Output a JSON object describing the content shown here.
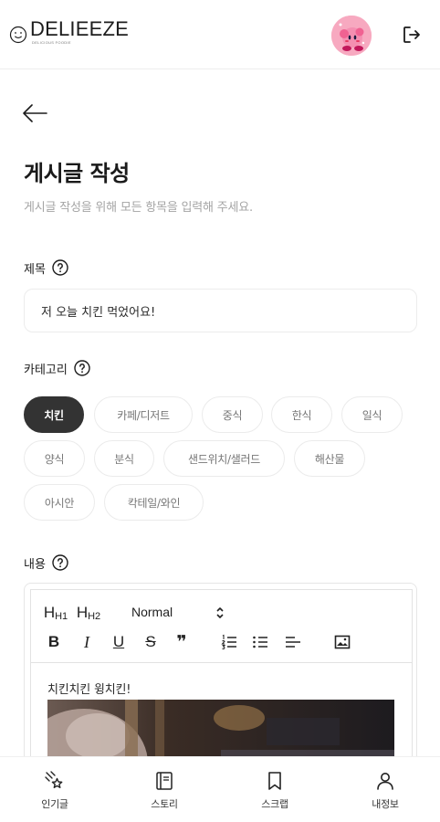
{
  "header": {
    "logo_text": "DELIEEZE",
    "logo_subtext": "DELICIOUS FOODIE"
  },
  "page": {
    "title": "게시글 작성",
    "subtitle": "게시글 작성을 위해 모든 항목을 입력해 주세요."
  },
  "fields": {
    "title_label": "제목",
    "title_value": "저 오늘 치킨 먹었어요!",
    "category_label": "카테고리",
    "content_label": "내용"
  },
  "categories": [
    {
      "label": "치킨",
      "selected": true
    },
    {
      "label": "카페/디저트",
      "selected": false
    },
    {
      "label": "중식",
      "selected": false
    },
    {
      "label": "한식",
      "selected": false
    },
    {
      "label": "일식",
      "selected": false
    },
    {
      "label": "양식",
      "selected": false
    },
    {
      "label": "분식",
      "selected": false
    },
    {
      "label": "샌드위치/샐러드",
      "selected": false
    },
    {
      "label": "해산물",
      "selected": false
    },
    {
      "label": "아시안",
      "selected": false
    },
    {
      "label": "칵테일/와인",
      "selected": false
    }
  ],
  "editor": {
    "toolbar": {
      "h1": "H1",
      "h2": "H2",
      "header_select": "Normal",
      "bold": "B",
      "italic": "I",
      "underline": "U",
      "strike": "S",
      "quote": "❞"
    },
    "content_text": "치킨치킨 윙치킨!"
  },
  "nav": {
    "items": [
      {
        "label": "인기글",
        "icon": "sparkle-stars-icon"
      },
      {
        "label": "스토리",
        "icon": "book-icon"
      },
      {
        "label": "스크랩",
        "icon": "bookmark-icon"
      },
      {
        "label": "내정보",
        "icon": "person-icon"
      }
    ]
  },
  "colors": {
    "selected_chip": "#333333",
    "avatar_bg": "#f7a9c0",
    "border": "#ececec",
    "subtitle": "#a4a4a4"
  }
}
